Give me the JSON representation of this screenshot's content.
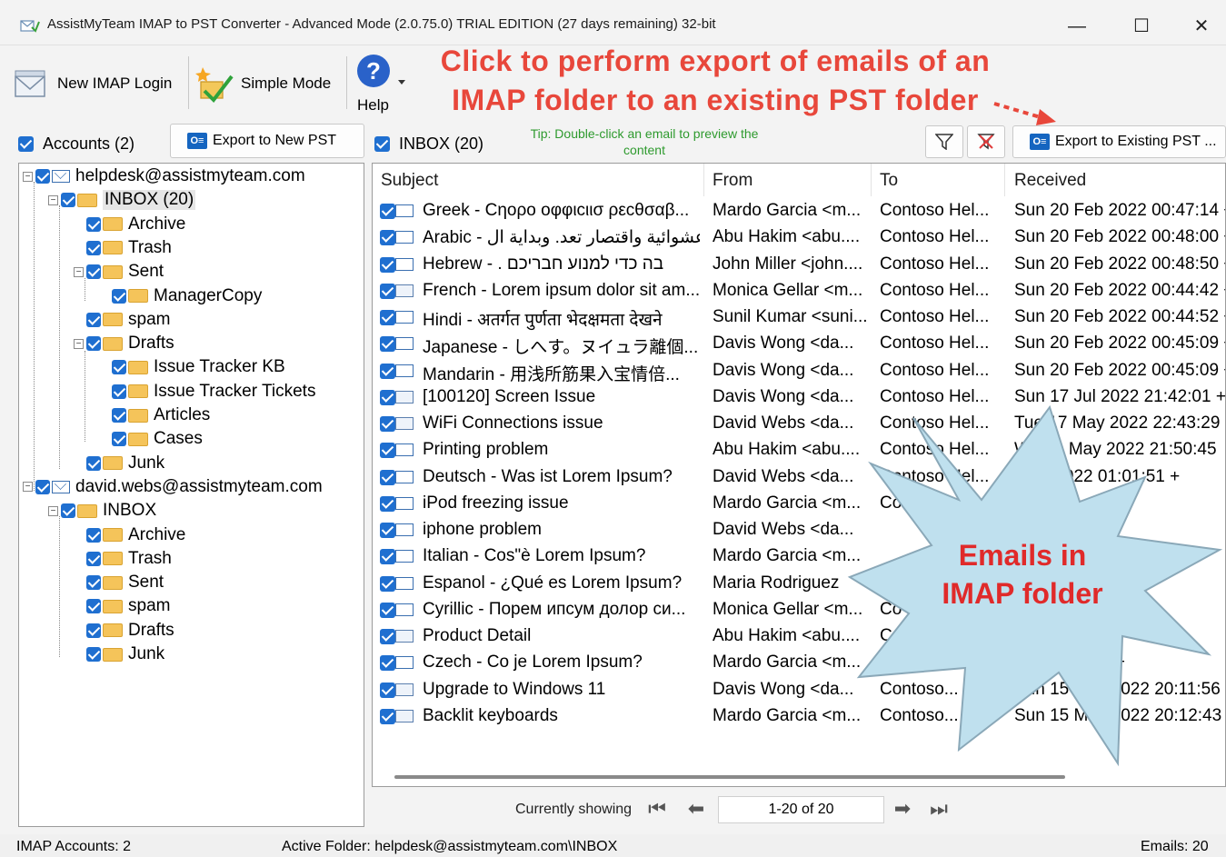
{
  "window": {
    "title": "AssistMyTeam IMAP to PST Converter - Advanced Mode (2.0.75.0) TRIAL EDITION (27 days remaining) 32-bit",
    "minimize": "—",
    "maximize": "☐",
    "close": "✕"
  },
  "toolbar": {
    "new_imap_login": "New IMAP Login",
    "simple_mode": "Simple Mode",
    "help": "Help",
    "help_glyph": "?"
  },
  "callout_top": {
    "line1": "Click to perform export of emails of an",
    "line2": "IMAP folder to an existing PST folder"
  },
  "accounts_panel": {
    "label": "Accounts (2)",
    "export_new_pst": "Export to New PST"
  },
  "folder_panel": {
    "label": "INBOX (20)",
    "tip_line1": "Tip: Double-click an email to preview the",
    "tip_line2": "content",
    "export_existing_pst": "Export to Existing PST ..."
  },
  "tree": [
    {
      "label": "helpdesk@assistmyteam.com",
      "type": "account"
    },
    {
      "label": "INBOX (20)",
      "type": "folder",
      "selected": true
    },
    {
      "label": "Archive",
      "type": "folder"
    },
    {
      "label": "Trash",
      "type": "folder"
    },
    {
      "label": "Sent",
      "type": "folder"
    },
    {
      "label": "ManagerCopy",
      "type": "folder"
    },
    {
      "label": "spam",
      "type": "folder"
    },
    {
      "label": "Drafts",
      "type": "folder"
    },
    {
      "label": "Issue Tracker KB",
      "type": "folder"
    },
    {
      "label": "Issue Tracker Tickets",
      "type": "folder"
    },
    {
      "label": "Articles",
      "type": "folder"
    },
    {
      "label": "Cases",
      "type": "folder"
    },
    {
      "label": "Junk",
      "type": "folder"
    },
    {
      "label": "david.webs@assistmyteam.com",
      "type": "account"
    },
    {
      "label": "INBOX",
      "type": "folder"
    },
    {
      "label": "Archive",
      "type": "folder"
    },
    {
      "label": "Trash",
      "type": "folder"
    },
    {
      "label": "Sent",
      "type": "folder"
    },
    {
      "label": "spam",
      "type": "folder"
    },
    {
      "label": "Drafts",
      "type": "folder"
    },
    {
      "label": "Junk",
      "type": "folder"
    }
  ],
  "grid": {
    "columns": [
      "Subject",
      "From",
      "To",
      "Received"
    ],
    "rows": [
      {
        "subject": "Greek - Cηορο οφφιcιισ ρεcθσαβ...",
        "from": "Mardo Garcia <m...",
        "to": "Contoso Hel...",
        "received": "Sun 20 Feb 2022 00:47:14 +",
        "attach": false
      },
      {
        "subject": "Arabic - عشوائية واقتصار تعد. وبداية ال...",
        "from": "Abu Hakim <abu....",
        "to": "Contoso Hel...",
        "received": "Sun 20 Feb 2022 00:48:00 +",
        "attach": false
      },
      {
        "subject": "Hebrew - . בה כדי למנוע חבריכם",
        "from": "John Miller <john....",
        "to": "Contoso Hel...",
        "received": "Sun 20 Feb 2022 00:48:50 +",
        "attach": false
      },
      {
        "subject": "French - Lorem ipsum dolor sit am...",
        "from": "Monica Gellar <m...",
        "to": "Contoso Hel...",
        "received": "Sun 20 Feb 2022 00:44:42 +",
        "attach": true
      },
      {
        "subject": "Hindi - अतर्गत पुर्णता भेदक्षमता देखने",
        "from": "Sunil Kumar <suni...",
        "to": "Contoso Hel...",
        "received": "Sun 20 Feb 2022 00:44:52 +",
        "attach": false
      },
      {
        "subject": "Japanese - しへす。ヌイュラ離個...",
        "from": "Davis Wong <da...",
        "to": "Contoso Hel...",
        "received": "Sun 20 Feb 2022 00:45:09 +",
        "attach": false
      },
      {
        "subject": "Mandarin - 用浅所筋果入宝情倍...",
        "from": "Davis Wong <da...",
        "to": "Contoso Hel...",
        "received": "Sun 20 Feb 2022 00:45:09 +",
        "attach": false
      },
      {
        "subject": "[100120] Screen Issue",
        "from": "Davis Wong <da...",
        "to": "Contoso Hel...",
        "received": "Sun 17 Jul 2022 21:42:01 +0",
        "attach": true
      },
      {
        "subject": "WiFi Connections issue",
        "from": "David Webs <da...",
        "to": "Contoso Hel...",
        "received": "Tue 17 May 2022 22:43:29 +",
        "attach": true
      },
      {
        "subject": "Printing problem",
        "from": "Abu Hakim <abu....",
        "to": "Contoso Hel...",
        "received": "Wed 1 May 2022 21:50:45",
        "attach": false
      },
      {
        "subject": "Deutsch - Was ist Lorem Ipsum?",
        "from": "David Webs <da...",
        "to": "Contoso Hel...",
        "received": "Su... 2022 01:01:51 +",
        "attach": false
      },
      {
        "subject": "iPod freezing issue",
        "from": "Mardo Garcia <m...",
        "to": "Co...",
        "received": "...3:56",
        "attach": false
      },
      {
        "subject": "iphone problem",
        "from": "David Webs <da...",
        "to": "",
        "received": "...18:52:45 +",
        "attach": false
      },
      {
        "subject": "Italian - Cos\"è Lorem Ipsum?",
        "from": "Mardo Garcia <m...",
        "to": "",
        "received": "...07:21 +",
        "attach": false
      },
      {
        "subject": " Espanol - ¿Qué es Lorem Ipsum?",
        "from": "Maria Rodriguez",
        "to": "",
        "received": "...:17 +",
        "attach": false
      },
      {
        "subject": "Cyrillic - Порем ипсум долор си...",
        "from": "Monica Gellar <m...",
        "to": "Co",
        "received": "...00:49:14 +",
        "attach": false
      },
      {
        "subject": "Product Detail",
        "from": "Abu Hakim <abu....",
        "to": "C",
        "received": "...59:56 +",
        "attach": true
      },
      {
        "subject": "Czech - Co je Lorem Ipsum?",
        "from": "Mardo Garcia <m...",
        "to": "Contoso H...",
        "received": "...2 00:57:49 +",
        "attach": false
      },
      {
        "subject": "Upgrade to Windows 11",
        "from": "Davis Wong <da...",
        "to": "Contoso...",
        "received": "Sun 15 May 2022 20:11:56 +",
        "attach": true
      },
      {
        "subject": "Backlit keyboards",
        "from": "Mardo Garcia <m...",
        "to": "Contoso...",
        "received": "Sun 15 May 2022 20:12:43 +",
        "attach": true
      }
    ]
  },
  "callout_star": {
    "line1": "Emails in",
    "line2": "IMAP folder"
  },
  "pager": {
    "label": "Currently showing",
    "value": "1-20 of 20"
  },
  "status": {
    "accounts": "IMAP Accounts: 2",
    "active_folder": "Active Folder: helpdesk@assistmyteam.com\\INBOX",
    "emails": "Emails: 20"
  },
  "colors": {
    "checkbox": "#1f6fd0",
    "callout_red": "#e8473b",
    "tip_green": "#2e9a2e",
    "star_fill": "#bfe0ee"
  }
}
